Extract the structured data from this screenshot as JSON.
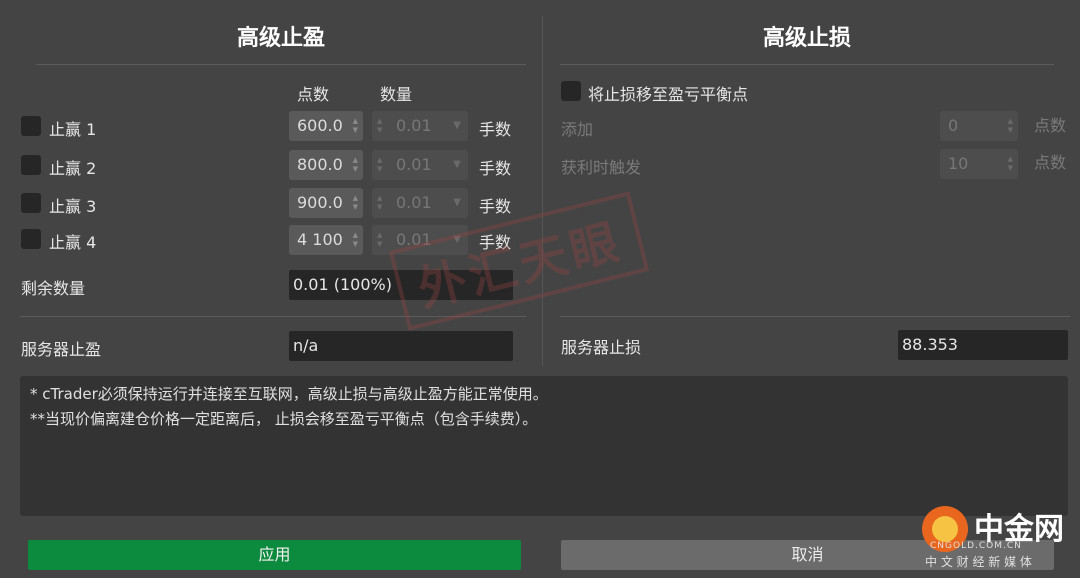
{
  "take_profit": {
    "title": "高级止盈",
    "col_points": "点数",
    "col_quantity": "数量",
    "rows": [
      {
        "label": "止赢 1",
        "points": "600.0",
        "quantity": "0.01",
        "unit": "手数"
      },
      {
        "label": "止赢 2",
        "points": "800.0",
        "quantity": "0.01",
        "unit": "手数"
      },
      {
        "label": "止赢 3",
        "points": "900.0",
        "quantity": "0.01",
        "unit": "手数"
      },
      {
        "label": "止赢 4",
        "points": "4 100",
        "quantity": "0.01",
        "unit": "手数"
      }
    ],
    "remaining_label": "剩余数量",
    "remaining_value": "0.01 (100%)",
    "server_label": "服务器止盈",
    "server_value": "n/a"
  },
  "stop_loss": {
    "title": "高级止损",
    "breakeven_label": "将止损移至盈亏平衡点",
    "add_label": "添加",
    "add_value": "0",
    "add_unit": "点数",
    "trigger_label": "获利时触发",
    "trigger_value": "10",
    "trigger_unit": "点数",
    "server_label": "服务器止损",
    "server_value": "88.353"
  },
  "notes": {
    "line1": "* cTrader必须保持运行并连接至互联网，高级止损与高级止盈方能正常使用。",
    "line2": "**当现价偏离建仓价格一定距离后， 止损会移至盈亏平衡点（包含手续费）。"
  },
  "buttons": {
    "apply": "应用",
    "cancel": "取消"
  },
  "watermark": {
    "stamp": "外汇天眼",
    "logo_main": "中金网",
    "logo_url": "CNGOLD.COM.CN",
    "logo_sub": "中 文 财 经 新 媒 体"
  },
  "colors": {
    "background": "#444444",
    "apply": "#0c8a3e",
    "cancel": "#6b6b6b",
    "field": "#262626"
  }
}
